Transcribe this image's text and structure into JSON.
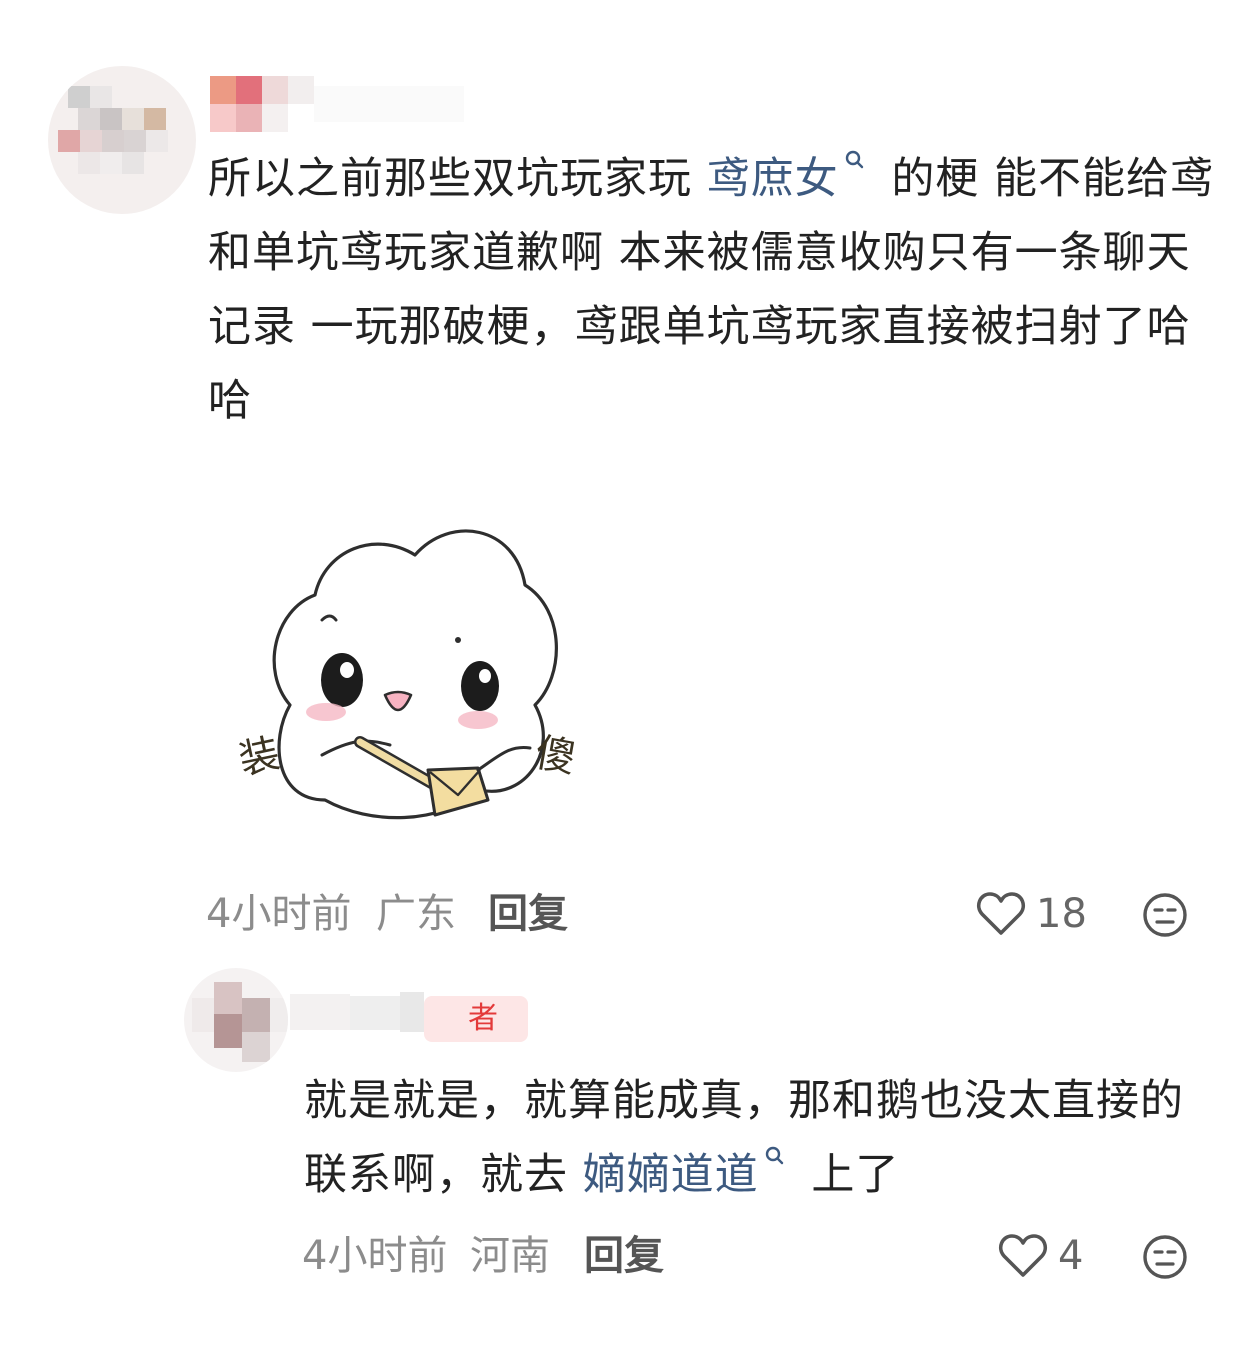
{
  "comment": {
    "text_before_link": "所以之前那些双坑玩家玩 ",
    "link_text": "鸢庶女",
    "text_after_link": " 的梗 能不能给鸢和单坑鸢玩家道歉啊 本来被儒意收购只有一条聊天记录 一玩那破梗，鸢跟单坑鸢玩家直接被扫射了哈哈",
    "time": "4小时前",
    "location": "广东",
    "reply_label": "回复",
    "likes": "18"
  },
  "reply": {
    "badge": "者",
    "text_before_link": "就是就是，就算能成真，那和鹅也没太直接的联系啊，就去 ",
    "link_text": "嫡嫡道道",
    "text_after_link": " 上了",
    "time": "4小时前",
    "location": "河南",
    "reply_label": "回复",
    "likes": "4"
  },
  "sticker_labels": {
    "left": "装",
    "right": "傻"
  },
  "icons": {
    "heart": "heart-outline-icon",
    "emoji": "neutral-face-icon",
    "search": "search-icon"
  },
  "colors": {
    "link": "#3d5a80",
    "badge_text": "#e33a3a",
    "meta": "#8c8c8c"
  }
}
